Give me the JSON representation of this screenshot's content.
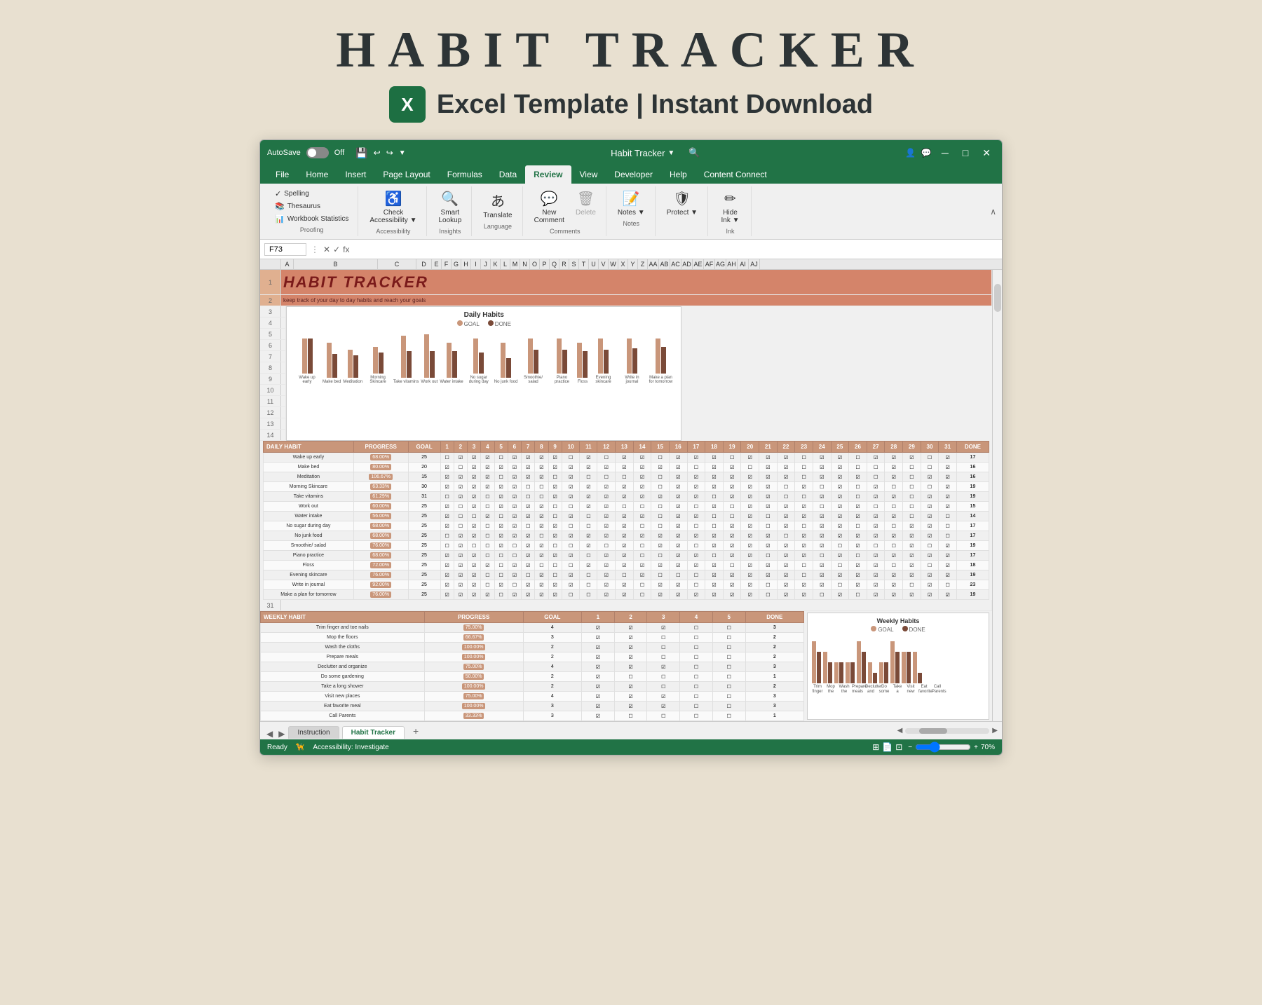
{
  "page": {
    "title": "HABIT TRACKER",
    "subtitle": "Excel Template | Instant Download",
    "background": "#e8e0d0"
  },
  "excel": {
    "window_title": "Habit Tracker",
    "autosave": "AutoSave",
    "autosave_state": "Off",
    "tabs": [
      "File",
      "Home",
      "Insert",
      "Page Layout",
      "Formulas",
      "Data",
      "Review",
      "View",
      "Developer",
      "Help",
      "Content Connect"
    ],
    "active_tab": "Review",
    "ribbon": {
      "proofing": {
        "label": "Proofing",
        "items": [
          "Spelling",
          "Thesaurus",
          "Workbook Statistics"
        ]
      },
      "accessibility": {
        "label": "Accessibility",
        "items": [
          "Check Accessibility"
        ]
      },
      "insights": {
        "label": "Insights",
        "items": [
          "Smart Lookup"
        ]
      },
      "language": {
        "label": "Language",
        "items": [
          "Translate"
        ]
      },
      "comments": {
        "label": "Comments",
        "items": [
          "New Comment",
          "Delete"
        ]
      },
      "notes": {
        "label": "Notes",
        "items": [
          "Notes"
        ]
      },
      "protect": {
        "label": "",
        "items": [
          "Protect"
        ]
      },
      "ink": {
        "label": "Ink",
        "items": [
          "Hide Ink"
        ]
      }
    },
    "formula_bar": {
      "cell_ref": "F73",
      "formula": ""
    },
    "spreadsheet": {
      "header_title": "HABIT TRACKER",
      "header_subtitle": "keep track of your day to day habits and reach your goals",
      "chart": {
        "title": "Daily Habits",
        "legend": [
          "GOAL",
          "DONE"
        ],
        "bars": [
          {
            "label": "Wake up early",
            "goal": 25,
            "done": 25
          },
          {
            "label": "Make bed",
            "goal": 25,
            "done": 17
          },
          {
            "label": "Meditation",
            "goal": 20,
            "done": 16
          },
          {
            "label": "Morning Skincare",
            "goal": 19,
            "done": 15
          },
          {
            "label": "Take vitamins",
            "goal": 30,
            "done": 19
          },
          {
            "label": "Work out",
            "goal": 31,
            "done": 19
          },
          {
            "label": "Water intake",
            "goal": 25,
            "done": 19
          },
          {
            "label": "No sugar during day",
            "goal": 25,
            "done": 15
          },
          {
            "label": "No junk food",
            "goal": 25,
            "done": 14
          },
          {
            "label": "Smoothie/ salad",
            "goal": 25,
            "done": 17
          },
          {
            "label": "Piano practice",
            "goal": 25,
            "done": 17
          },
          {
            "label": "Floss",
            "goal": 25,
            "done": 19
          },
          {
            "label": "Evening skincare",
            "goal": 25,
            "done": 17
          },
          {
            "label": "Write in journal",
            "goal": 25,
            "done": 18
          },
          {
            "label": "Make a plan for tomorrow",
            "goal": 25,
            "done": 19
          }
        ]
      },
      "daily_habits": {
        "headers": [
          "DAILY HABIT",
          "PROGRESS",
          "GOAL",
          "1",
          "2",
          "3",
          "4",
          "5",
          "6",
          "7",
          "8",
          "9",
          "10",
          "11",
          "12",
          "13",
          "14",
          "15",
          "16",
          "17",
          "18",
          "19",
          "20",
          "21",
          "22",
          "23",
          "24",
          "25",
          "26",
          "27",
          "28",
          "29",
          "30",
          "31",
          "DONE"
        ],
        "rows": [
          {
            "name": "Wake up early",
            "progress": "68.00%",
            "goal": 25,
            "done": 17
          },
          {
            "name": "Make bed",
            "progress": "80.00%",
            "goal": 20,
            "done": 16
          },
          {
            "name": "Meditation",
            "progress": "106.67%",
            "goal": 15,
            "done": 16
          },
          {
            "name": "Morning Skincare",
            "progress": "63.33%",
            "goal": 30,
            "done": 19
          },
          {
            "name": "Take vitamins",
            "progress": "61.29%",
            "goal": 31,
            "done": 19
          },
          {
            "name": "Work out",
            "progress": "60.00%",
            "goal": 25,
            "done": 15
          },
          {
            "name": "Water intake",
            "progress": "56.00%",
            "goal": 25,
            "done": 14
          },
          {
            "name": "No sugar during day",
            "progress": "68.00%",
            "goal": 25,
            "done": 17
          },
          {
            "name": "No junk food",
            "progress": "68.00%",
            "goal": 25,
            "done": 17
          },
          {
            "name": "Smoothie/ salad",
            "progress": "76.00%",
            "goal": 25,
            "done": 19
          },
          {
            "name": "Piano practice",
            "progress": "68.00%",
            "goal": 25,
            "done": 17
          },
          {
            "name": "Floss",
            "progress": "72.00%",
            "goal": 25,
            "done": 18
          },
          {
            "name": "Evening skincare",
            "progress": "76.00%",
            "goal": 25,
            "done": 19
          },
          {
            "name": "Write in journal",
            "progress": "92.00%",
            "goal": 25,
            "done": 23
          },
          {
            "name": "Make a plan for tomorrow",
            "progress": "76.00%",
            "goal": 25,
            "done": 19
          }
        ]
      },
      "weekly_habits": {
        "headers": [
          "WEEKLY HABIT",
          "PROGRESS",
          "GOAL",
          "1",
          "2",
          "3",
          "4",
          "5",
          "DONE"
        ],
        "rows": [
          {
            "name": "Trim finger and toe nails",
            "progress": "75.00%",
            "goal": 4,
            "done": 3
          },
          {
            "name": "Mop the floors",
            "progress": "66.67%",
            "goal": 3,
            "done": 2
          },
          {
            "name": "Wash the cloths",
            "progress": "100.00%",
            "goal": 2,
            "done": 2
          },
          {
            "name": "Prepare meals",
            "progress": "100.00%",
            "goal": 2,
            "done": 2
          },
          {
            "name": "Declutter and organize",
            "progress": "75.00%",
            "goal": 4,
            "done": 3
          },
          {
            "name": "Do some gardening",
            "progress": "50.00%",
            "goal": 2,
            "done": 1
          },
          {
            "name": "Take a long shower",
            "progress": "100.00%",
            "goal": 2,
            "done": 2
          },
          {
            "name": "Visit new places",
            "progress": "75.00%",
            "goal": 4,
            "done": 3
          },
          {
            "name": "Eat favorite meal",
            "progress": "100.00%",
            "goal": 3,
            "done": 3
          },
          {
            "name": "Call Parents",
            "progress": "33.33%",
            "goal": 3,
            "done": 1
          }
        ]
      }
    },
    "sheet_tabs": [
      "Instruction",
      "Habit Tracker"
    ],
    "active_sheet": "Habit Tracker",
    "status_bar": {
      "ready": "Ready",
      "accessibility": "Accessibility: Investigate",
      "zoom": "70%"
    }
  }
}
